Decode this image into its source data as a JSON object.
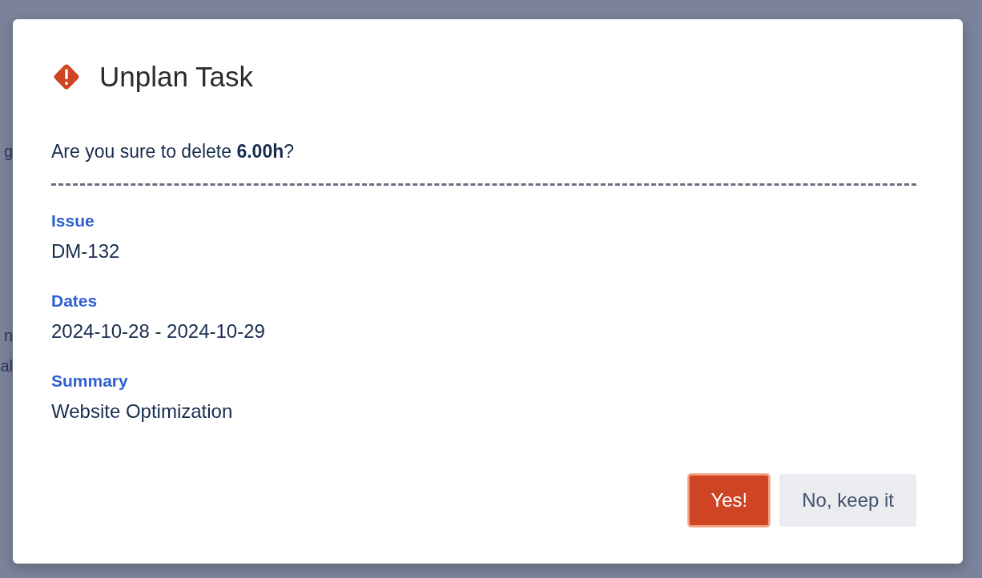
{
  "background": {
    "fragments": [
      "g",
      "n",
      "al"
    ]
  },
  "dialog": {
    "title": "Unplan Task",
    "message": "Are you sure to delete **6.00h**?",
    "fields": [
      {
        "label": "Issue",
        "value": "DM-132"
      },
      {
        "label": "Dates",
        "value": "2024-10-28 - 2024-10-29"
      },
      {
        "label": "Summary",
        "value": "Website Optimization"
      }
    ],
    "buttons": [
      {
        "label": "Yes!",
        "kind": "danger"
      },
      {
        "label": "No, keep it",
        "kind": "subtle"
      }
    ]
  }
}
